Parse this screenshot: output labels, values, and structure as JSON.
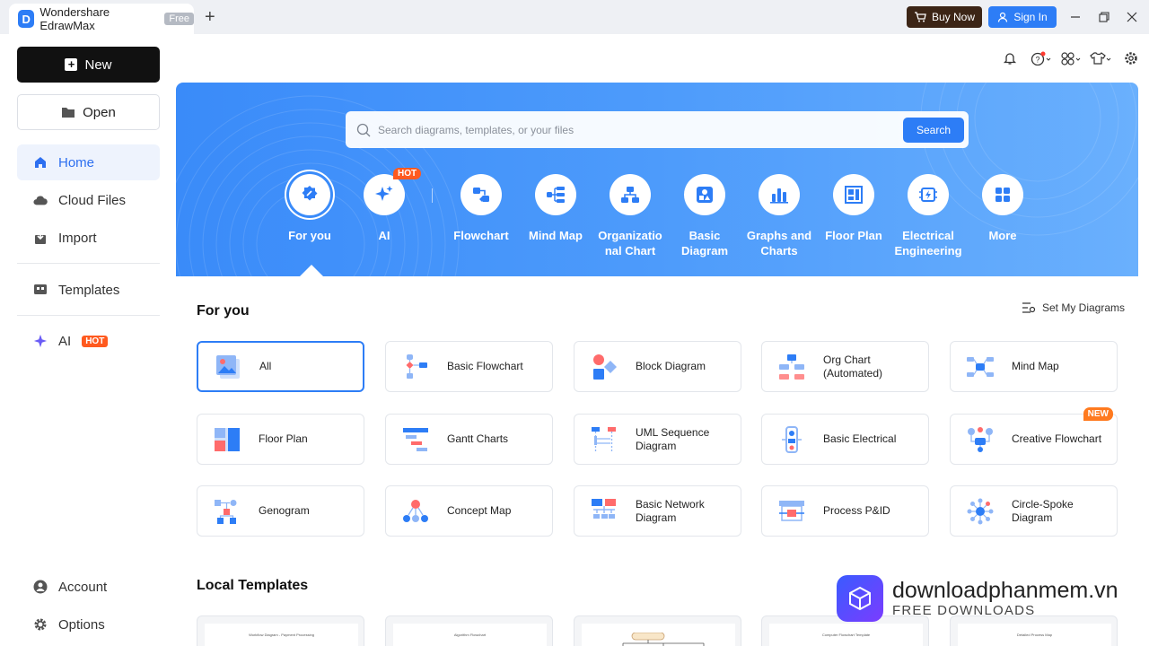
{
  "titlebar": {
    "app_title": "Wondershare EdrawMax",
    "free_badge": "Free",
    "new_tab": "+",
    "buy_label": "Buy Now",
    "signin_label": "Sign In"
  },
  "sidebar": {
    "new_label": "New",
    "open_label": "Open",
    "items": [
      {
        "label": "Home"
      },
      {
        "label": "Cloud Files"
      },
      {
        "label": "Import"
      },
      {
        "label": "Templates"
      },
      {
        "label": "AI",
        "badge": "HOT"
      },
      {
        "label": "Account"
      },
      {
        "label": "Options"
      }
    ]
  },
  "search": {
    "placeholder": "Search diagrams, templates, or your files",
    "button": "Search"
  },
  "categories": [
    {
      "label": "For you",
      "icon": "sparkle-badge-icon"
    },
    {
      "label": "AI",
      "icon": "ai-sparkle-icon",
      "badge": "HOT"
    },
    {
      "label": "Flowchart",
      "icon": "flowchart-icon"
    },
    {
      "label": "Mind Map",
      "icon": "mind-map-icon"
    },
    {
      "label": "Organizational Chart",
      "line1": "Organizatio",
      "line2": "nal Chart",
      "icon": "org-chart-icon"
    },
    {
      "label": "Basic Diagram",
      "line1": "Basic",
      "line2": "Diagram",
      "icon": "basic-diagram-icon"
    },
    {
      "label": "Graphs and Charts",
      "line1": "Graphs and",
      "line2": "Charts",
      "icon": "bar-chart-icon"
    },
    {
      "label": "Floor Plan",
      "icon": "floor-plan-icon"
    },
    {
      "label": "Electrical Engineering",
      "line1": "Electrical",
      "line2": "Engineering",
      "icon": "electrical-icon"
    },
    {
      "label": "More",
      "icon": "grid-icon"
    }
  ],
  "for_you": {
    "title": "For you",
    "set_link": "Set My Diagrams",
    "cards": [
      {
        "label": "All"
      },
      {
        "label": "Basic Flowchart"
      },
      {
        "label": "Block Diagram"
      },
      {
        "label": "Org Chart (Automated)",
        "line1": "Org Chart",
        "line2": "(Automated)"
      },
      {
        "label": "Mind Map"
      },
      {
        "label": "Floor Plan"
      },
      {
        "label": "Gantt Charts"
      },
      {
        "label": "UML Sequence Diagram",
        "line1": "UML Sequence",
        "line2": "Diagram"
      },
      {
        "label": "Basic Electrical"
      },
      {
        "label": "Creative Flowchart",
        "badge": "NEW"
      },
      {
        "label": "Genogram"
      },
      {
        "label": "Concept Map"
      },
      {
        "label": "Basic Network Diagram",
        "line1": "Basic Network",
        "line2": "Diagram"
      },
      {
        "label": "Process P&ID"
      },
      {
        "label": "Circle-Spoke Diagram",
        "line1": "Circle-Spoke",
        "line2": "Diagram"
      }
    ]
  },
  "local_templates": {
    "title": "Local Templates",
    "items": [
      {
        "caption": "Workflow Diagram - Payment Processing"
      },
      {
        "caption": "Algorithm Flowchart"
      },
      {
        "caption": ""
      },
      {
        "caption": "Computer Flowchart Template"
      },
      {
        "caption": "Detailed Process Map"
      }
    ]
  },
  "watermark": {
    "line1": "downloadphanmem.vn",
    "line2": "FREE DOWNLOADS"
  },
  "colors": {
    "accent": "#2d7df6",
    "banner_start": "#3a8bf9",
    "banner_end": "#6ab0fd",
    "hot": "#ff5a1f",
    "buy_button": "#3c2516"
  }
}
